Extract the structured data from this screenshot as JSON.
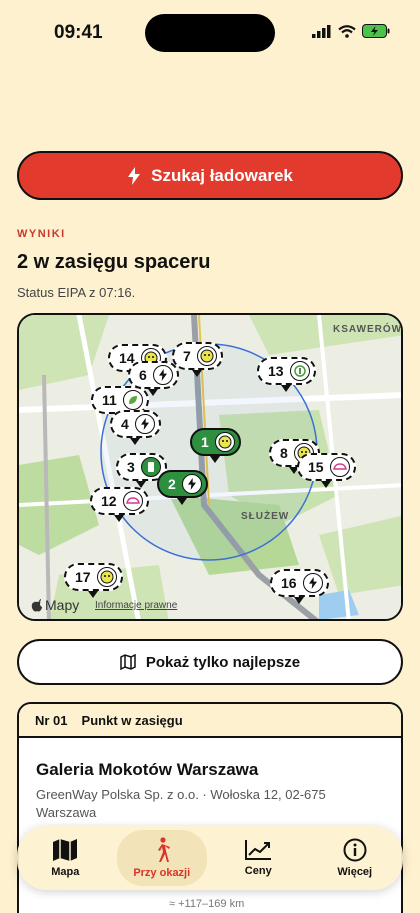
{
  "status_bar": {
    "time": "09:41"
  },
  "search_button": {
    "label": "Szukaj ładowarek",
    "icon": "bolt-icon"
  },
  "results": {
    "section_label": "WYNIKI",
    "title": "2 w zasięgu spaceru",
    "status": "Status EIPA z 07:16."
  },
  "map": {
    "district_labels": [
      "KSAWERÓW",
      "SŁUŻEW"
    ],
    "attribution": "Mapy",
    "legal": "Informacje prawne",
    "pins": [
      {
        "num": "14",
        "icon": "smiley-icon",
        "active": false
      },
      {
        "num": "7",
        "icon": "smiley-icon",
        "active": false
      },
      {
        "num": "6",
        "icon": "bolt-icon",
        "active": false
      },
      {
        "num": "13",
        "icon": "plug-icon",
        "active": false
      },
      {
        "num": "11",
        "icon": "leaf-icon",
        "active": false
      },
      {
        "num": "4",
        "icon": "bolt-icon",
        "active": false
      },
      {
        "num": "1",
        "icon": "smiley-icon",
        "active": true
      },
      {
        "num": "8",
        "icon": "smiley-icon",
        "active": false
      },
      {
        "num": "15",
        "icon": "car-icon",
        "active": false
      },
      {
        "num": "3",
        "icon": "station-icon",
        "active": false
      },
      {
        "num": "2",
        "icon": "bolt-icon",
        "active": true
      },
      {
        "num": "12",
        "icon": "car-icon",
        "active": false
      },
      {
        "num": "17",
        "icon": "smiley-icon",
        "active": false
      },
      {
        "num": "16",
        "icon": "bolt-icon",
        "active": false
      }
    ]
  },
  "best_button": {
    "label": "Pokaż tylko najlepsze",
    "icon": "map-icon"
  },
  "card": {
    "number": "Nr 01",
    "tag": "Punkt w zasięgu",
    "title": "Galeria Mokotów Warszawa",
    "address": "GreenWay Polska Sp. z o.o. · Wołoska 12, 02-675 Warszawa",
    "extra": "≈ +117–169 km"
  },
  "tabbar": {
    "tabs": [
      {
        "label": "Mapa",
        "icon": "map-icon",
        "active": false
      },
      {
        "label": "Przy okazji",
        "icon": "walking-icon",
        "active": true
      },
      {
        "label": "Ceny",
        "icon": "chart-icon",
        "active": false
      },
      {
        "label": "Więcej",
        "icon": "info-icon",
        "active": false
      }
    ]
  },
  "colors": {
    "background": "#fdf1cf",
    "accent": "#e23b2e",
    "active_pin": "#2e8f3e",
    "radius": "#3a6fd8"
  }
}
